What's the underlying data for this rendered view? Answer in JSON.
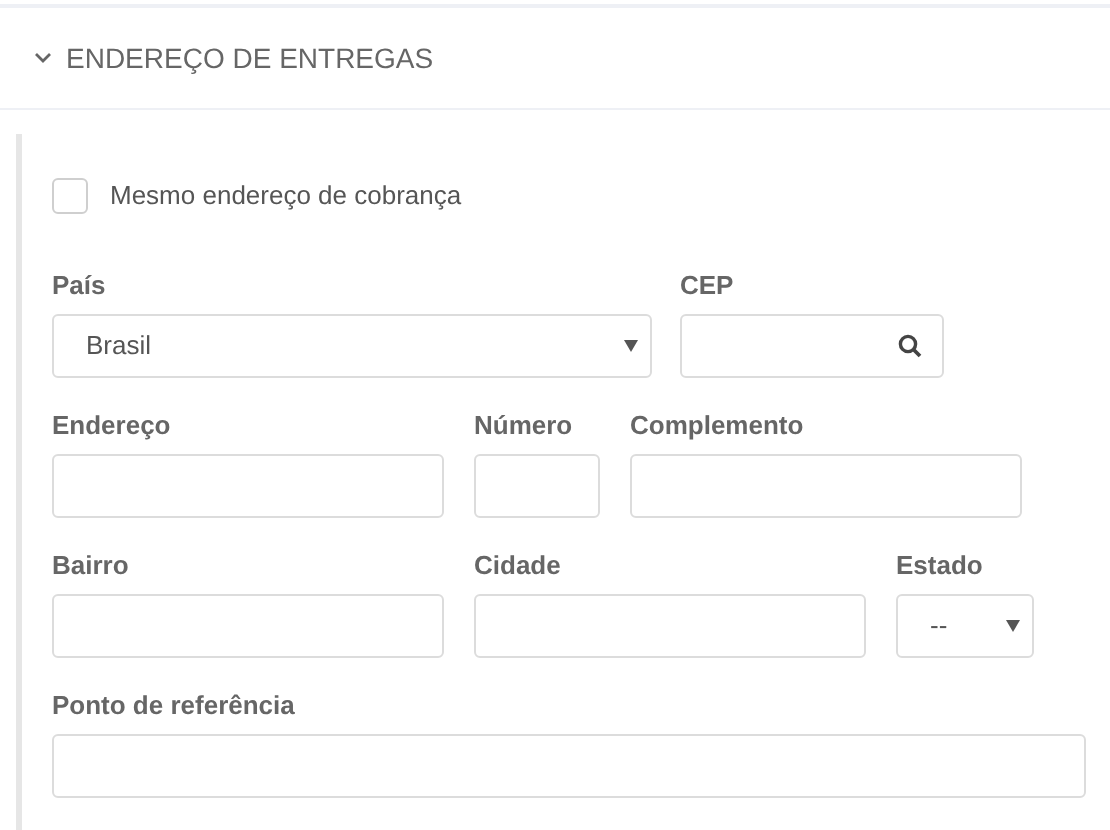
{
  "section": {
    "title": "ENDEREÇO DE ENTREGAS",
    "expanded": true
  },
  "same_as_billing": {
    "label": "Mesmo endereço de cobrança",
    "checked": false
  },
  "rows": [
    [
      {
        "label": "País",
        "kind": "select",
        "value": "Brasil"
      },
      {
        "label": "CEP",
        "kind": "search"
      }
    ],
    [
      {
        "label": "Endereço",
        "kind": "input"
      },
      {
        "label": "Número",
        "kind": "input"
      },
      {
        "label": "Complemento",
        "kind": "input"
      }
    ],
    [
      {
        "label": "Bairro",
        "kind": "input"
      },
      {
        "label": "Cidade",
        "kind": "input"
      },
      {
        "label": "Estado",
        "kind": "select",
        "value": "--"
      }
    ],
    [
      {
        "label": "Ponto de referência",
        "kind": "input"
      }
    ]
  ]
}
